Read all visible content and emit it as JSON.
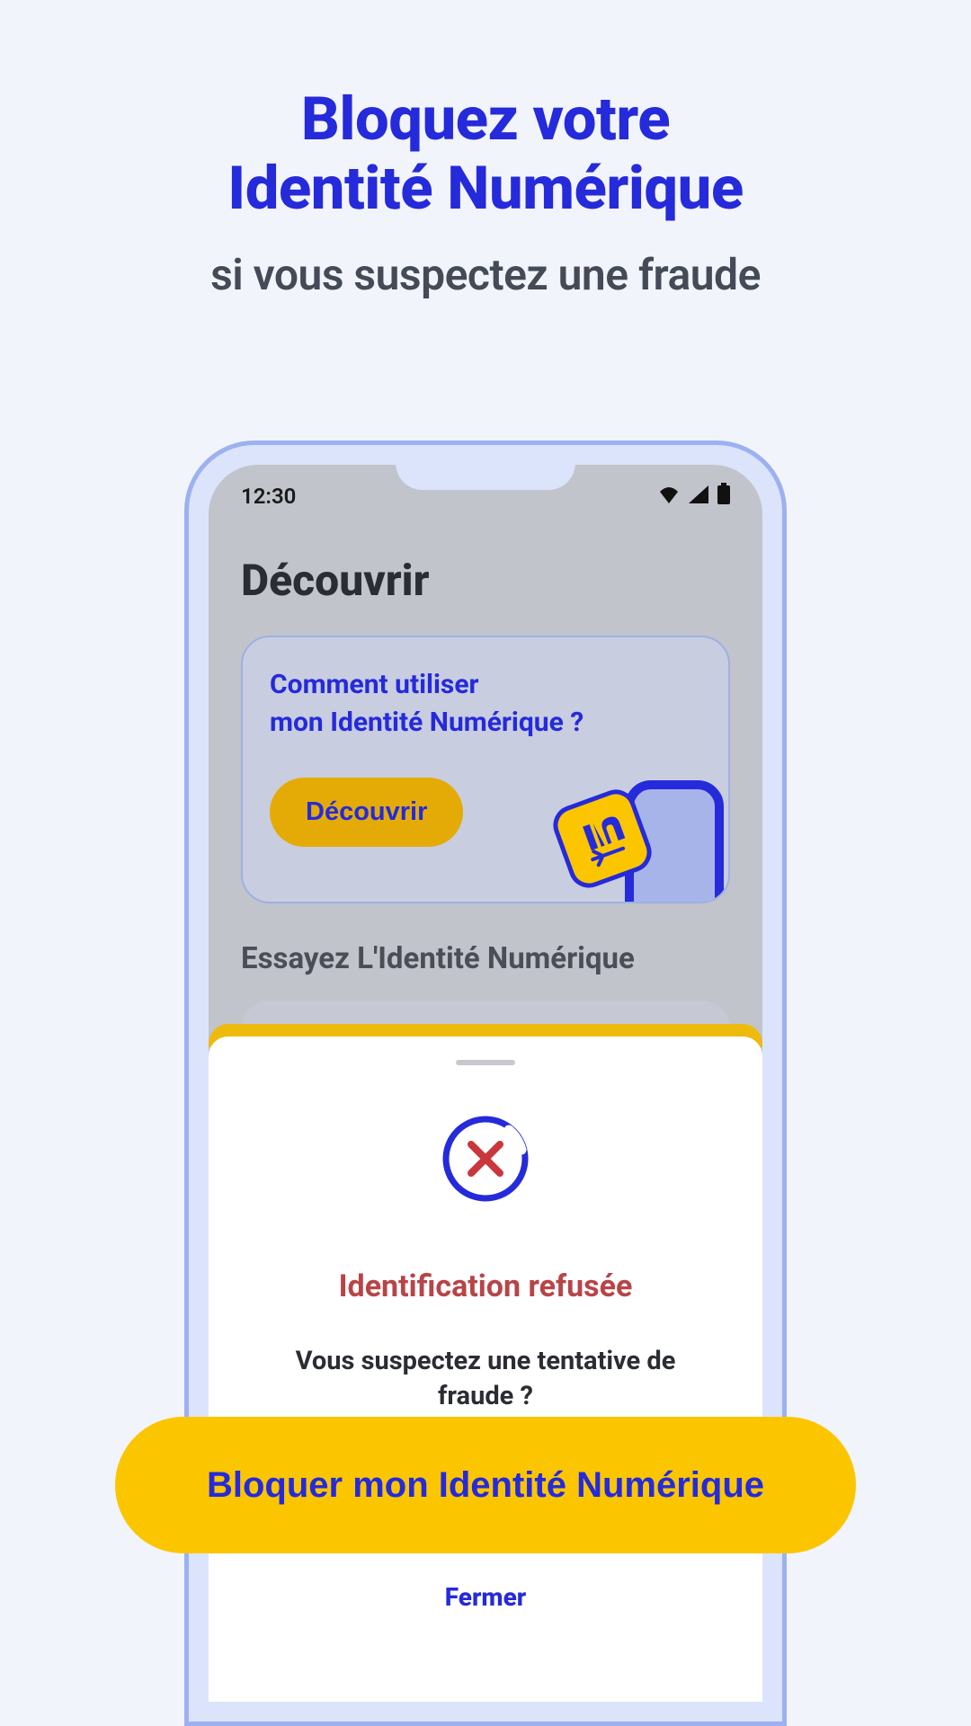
{
  "headline": {
    "line1": "Bloquez votre",
    "line2": "Identité Numérique",
    "sub": "si vous suspectez une fraude"
  },
  "statusbar": {
    "time": "12:30"
  },
  "page": {
    "title": "Découvrir",
    "discover_card": {
      "question_l1": "Comment utiliser",
      "question_l2": "mon Identité Numérique ?",
      "button": "Découvrir"
    },
    "try_section": {
      "title": "Essayez L'Identité Numérique"
    }
  },
  "sheet": {
    "title": "Identification refusée",
    "text": "Vous suspectez une tentative de fraude ?",
    "close": "Fermer"
  },
  "cta": {
    "block": "Bloquer mon Identité Numérique"
  },
  "colors": {
    "brand_blue": "#252adb",
    "brand_yellow": "#fbc500",
    "accent_yellow": "#e4ab07",
    "error_red": "#b74548"
  }
}
